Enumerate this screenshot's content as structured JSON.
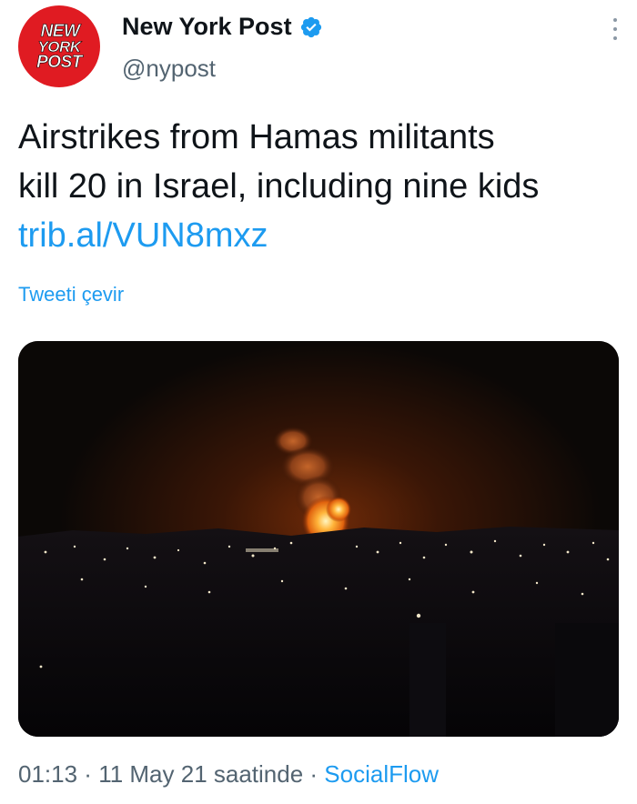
{
  "author": {
    "avatar_text": [
      "NEW",
      "YORK",
      "POST"
    ],
    "display_name": "New York Post",
    "handle": "@nypost",
    "verified": true,
    "avatar_color": "#e01b22"
  },
  "tweet": {
    "text_line1": "Airstrikes from Hamas militants",
    "text_line2": "kill 20 in Israel, including nine kids",
    "link": "trib.al/VUN8mxz",
    "translate_label": "Tweeti çevir"
  },
  "footer": {
    "time": "01:13",
    "sep1": " · ",
    "date": "11 May 21 saatinde",
    "sep2": " · ",
    "source": "SocialFlow"
  },
  "colors": {
    "link": "#1d9bf0",
    "secondary_text": "#536471",
    "primary_text": "#0f1419"
  },
  "icons": {
    "verified": "verified-badge-icon",
    "more": "more-options-icon"
  }
}
